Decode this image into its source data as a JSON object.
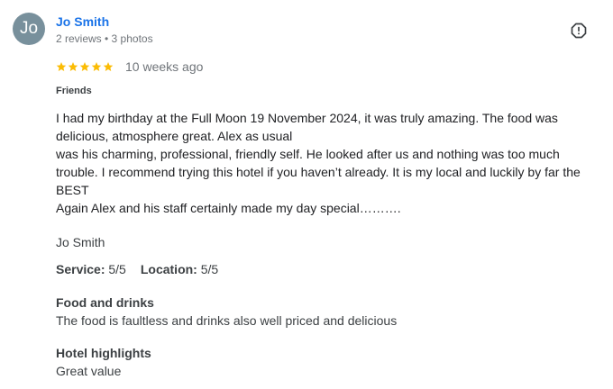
{
  "review": {
    "author": {
      "initials": "Jo",
      "name": "Jo Smith",
      "meta": "2 reviews • 3 photos",
      "avatar_color": "#78909c"
    },
    "report_icon": "report-flag-icon",
    "rating": 5,
    "star_color": "#fbbc04",
    "date": "10 weeks ago",
    "trip_type": "Friends",
    "body_lines": [
      "I had my birthday at the Full Moon 19 November 2024, it was truly amazing. The food was delicious, atmosphere great. Alex as usual",
      "was his charming, professional, friendly self. He looked after us and nothing was too much trouble. I recommend trying this hotel if you haven’t already. It is my local and luckily by far the BEST",
      "Again Alex and his staff certainly made my day special………."
    ],
    "signoff": "Jo Smith",
    "scores": {
      "service_label": "Service:",
      "service_value": "5/5",
      "location_label": "Location:",
      "location_value": "5/5"
    },
    "sections": {
      "food_title": "Food and drinks",
      "food_value": "The food is faultless and drinks also well priced and delicious",
      "highlights_title": "Hotel highlights",
      "highlights_value": "Great value"
    }
  }
}
